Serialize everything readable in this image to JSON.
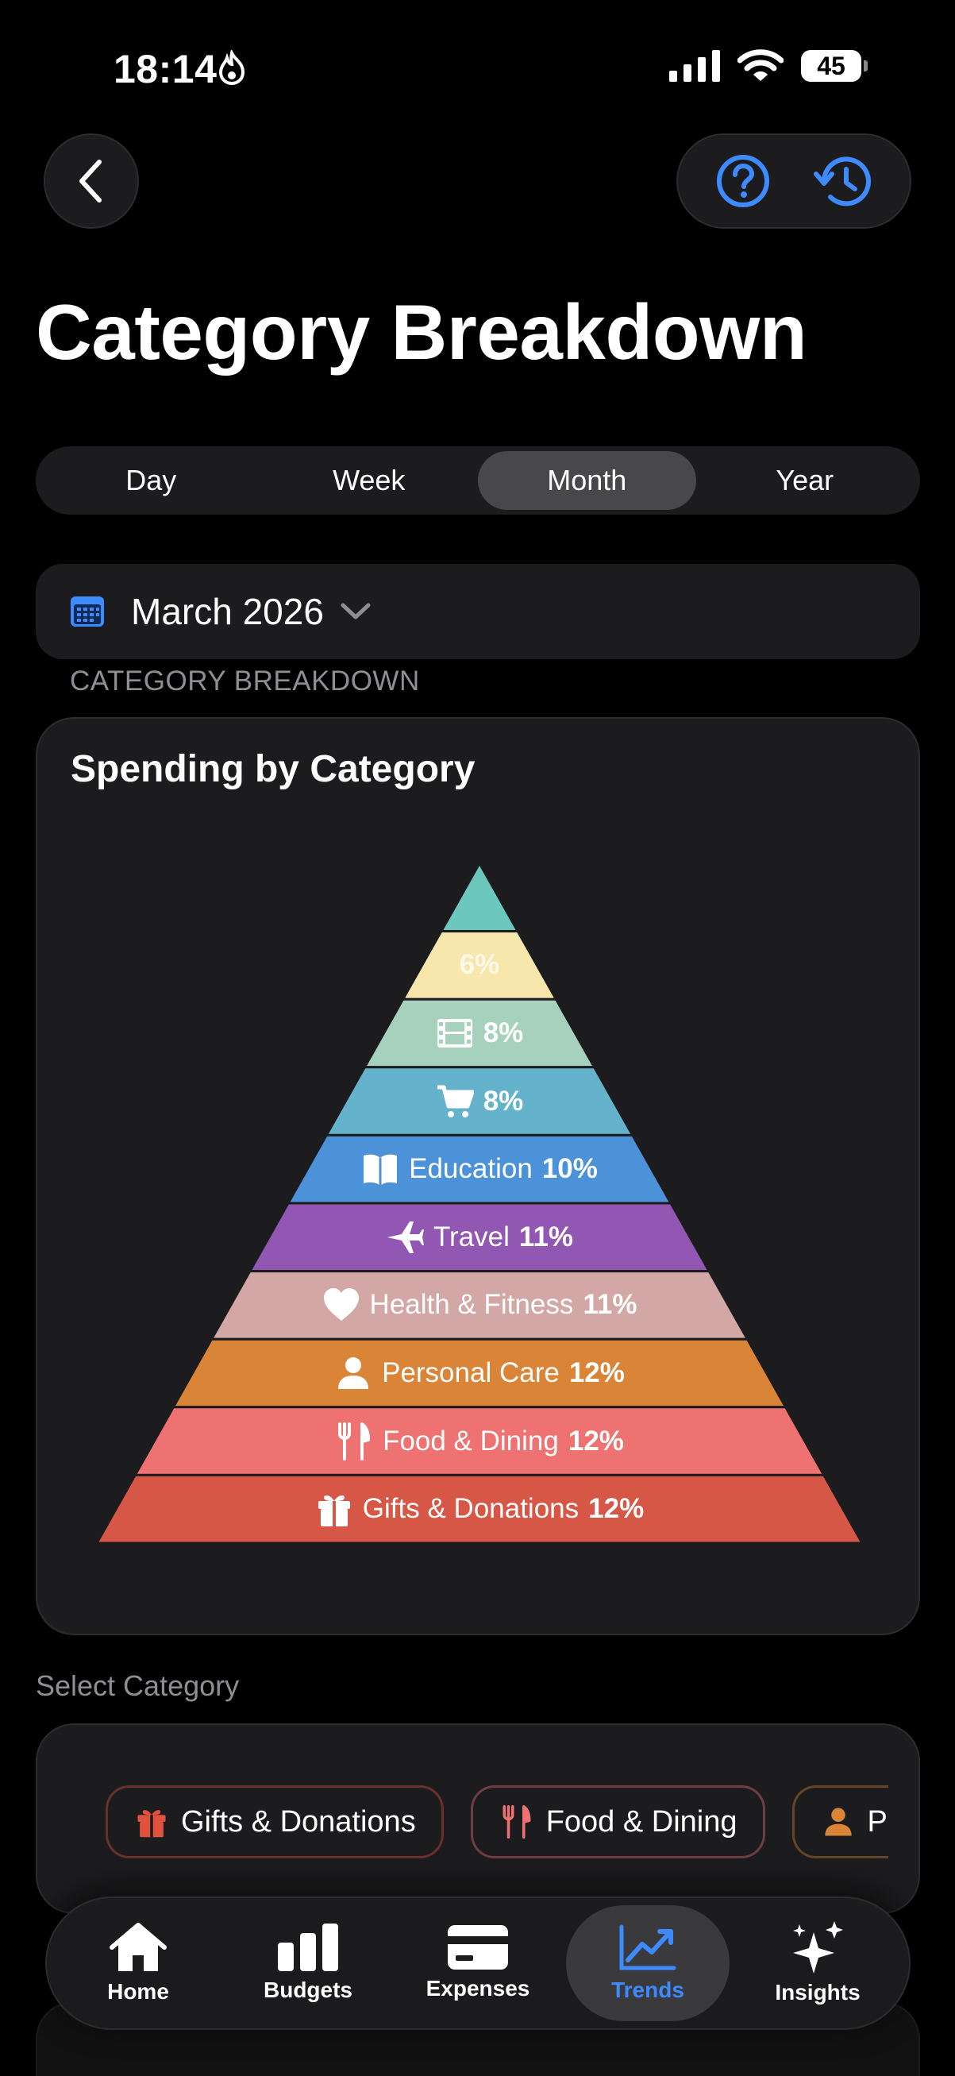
{
  "status_bar": {
    "time": "18:14",
    "battery": "45"
  },
  "header": {
    "title": "Category Breakdown"
  },
  "period_tabs": [
    {
      "label": "Day",
      "active": false
    },
    {
      "label": "Week",
      "active": false
    },
    {
      "label": "Month",
      "active": true
    },
    {
      "label": "Year",
      "active": false
    }
  ],
  "date_picker": {
    "label": "March 2026"
  },
  "section_label": "CATEGORY BREAKDOWN",
  "chart": {
    "title": "Spending by Category"
  },
  "chart_data": {
    "type": "pyramid",
    "unit": "%",
    "levels": [
      {
        "label": "",
        "value": null,
        "color": "#6cc7bc",
        "icon": ""
      },
      {
        "label": "",
        "value": 6,
        "color": "#f8e7ad",
        "icon": ""
      },
      {
        "label": "",
        "value": 8,
        "color": "#a6d2bd",
        "icon": "film-icon"
      },
      {
        "label": "",
        "value": 8,
        "color": "#64b2cc",
        "icon": "cart-icon"
      },
      {
        "label": "Education",
        "value": 10,
        "color": "#4c92d8",
        "icon": "book-icon"
      },
      {
        "label": "Travel",
        "value": 11,
        "color": "#9157b3",
        "icon": "airplane-icon"
      },
      {
        "label": "Health & Fitness",
        "value": 11,
        "color": "#d3a7a6",
        "icon": "heart-icon"
      },
      {
        "label": "Personal Care",
        "value": 12,
        "color": "#d98436",
        "icon": "person-icon"
      },
      {
        "label": "Food & Dining",
        "value": 12,
        "color": "#ee7272",
        "icon": "utensils-icon"
      },
      {
        "label": "Gifts & Donations",
        "value": 12,
        "color": "#d75747",
        "icon": "gift-icon"
      }
    ]
  },
  "select_category": {
    "label": "Select Category",
    "chips": [
      {
        "label": "Gifts & Donations",
        "icon": "gift-icon",
        "color": "#e0513e"
      },
      {
        "label": "Food & Dining",
        "icon": "utensils-icon",
        "color": "#ee7272"
      },
      {
        "label": "P",
        "icon": "person-icon",
        "color": "#d98436"
      }
    ]
  },
  "tab_bar": {
    "items": [
      {
        "label": "Home",
        "icon": "home-icon",
        "active": false
      },
      {
        "label": "Budgets",
        "icon": "bar-chart-icon",
        "active": false
      },
      {
        "label": "Expenses",
        "icon": "credit-card-icon",
        "active": false
      },
      {
        "label": "Trends",
        "icon": "trend-line-icon",
        "active": true
      },
      {
        "label": "Insights",
        "icon": "sparkles-icon",
        "active": false
      }
    ]
  },
  "colors": {
    "accent": "#3d8bff",
    "card": "#1c1c1e",
    "background": "#000000"
  }
}
